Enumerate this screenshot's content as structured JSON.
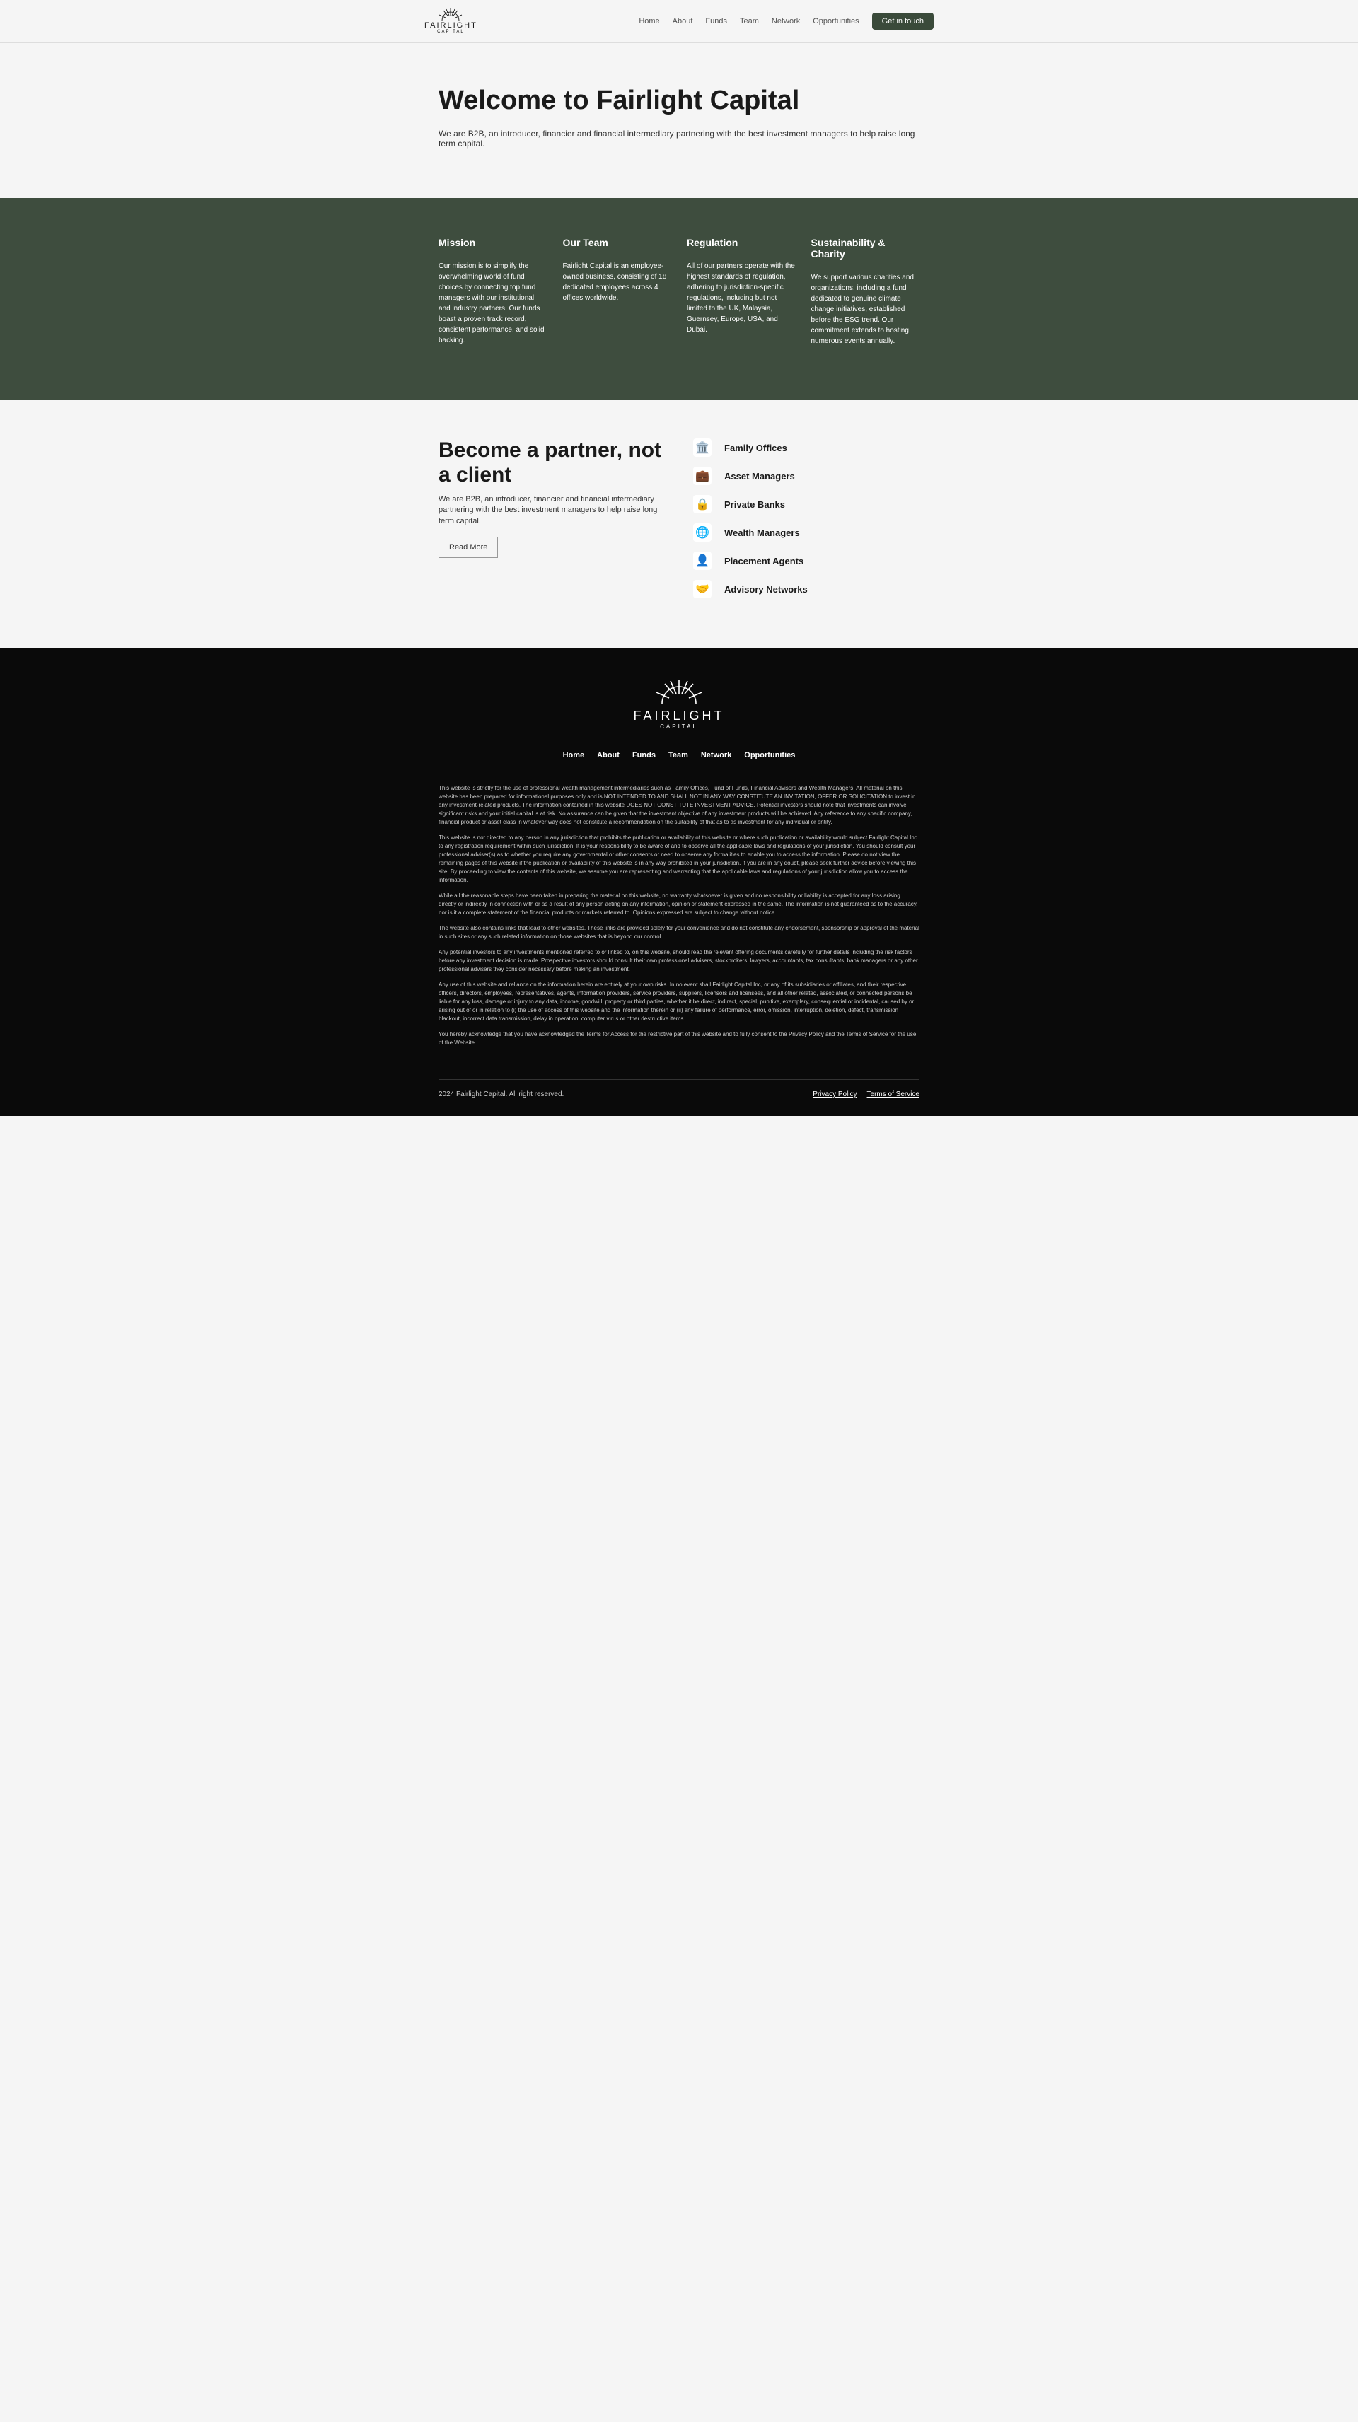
{
  "brand": {
    "name": "FAIRLIGHT",
    "sub": "CAPITAL"
  },
  "nav": {
    "home": "Home",
    "about": "About",
    "funds": "Funds",
    "team": "Team",
    "network": "Network",
    "opportunities": "Opportunities",
    "cta": "Get in touch"
  },
  "hero": {
    "title": "Welcome to Fairlight Capital",
    "sub": "We are B2B, an introducer, financier and financial intermediary partnering with the best investment managers to help raise long term capital."
  },
  "band": {
    "c1": {
      "h": "Mission",
      "p": "Our mission is to simplify the overwhelming world of fund choices by connecting top fund managers with our institutional and industry partners. Our funds boast a proven track record, consistent performance, and solid backing."
    },
    "c2": {
      "h": "Our Team",
      "p": "Fairlight Capital is an employee-owned business, consisting of 18 dedicated employees across 4 offices worldwide."
    },
    "c3": {
      "h": "Regulation",
      "p": "All of our partners operate with the highest standards of regulation, adhering to jurisdiction-specific regulations, including but not limited to the UK, Malaysia, Guernsey, Europe, USA, and Dubai."
    },
    "c4": {
      "h": "Sustainability & Charity",
      "p": "We support various charities and organizations, including a fund dedicated to genuine climate change initiatives, established before the ESG trend. Our commitment extends to hosting numerous events annually."
    }
  },
  "partner": {
    "title": "Become a partner, not a client",
    "sub": "We are B2B, an introducer, financier and financial intermediary partnering with the best investment managers to help raise long term capital.",
    "btn": "Read More",
    "items": {
      "i1": "Family Offices",
      "i2": "Asset Managers",
      "i3": "Private Banks",
      "i4": "Wealth Managers",
      "i5": "Placement Agents",
      "i6": "Advisory Networks"
    }
  },
  "disclaimer": {
    "p1": "This website is strictly for the use of professional wealth management intermediaries such as Family Offices, Fund of Funds, Financial Advisors and Wealth Managers. All material on this website has been prepared for informational purposes only and is NOT INTENDED TO AND SHALL NOT IN ANY WAY CONSTITUTE AN INVITATION, OFFER OR SOLICITATION to invest in any investment-related products. The information contained in this website DOES NOT CONSTITUTE INVESTMENT ADVICE. Potential investors should note that investments can involve significant risks and your initial capital is at risk. No assurance can be given that the investment objective of any investment products will be achieved. Any reference to any specific company, financial product or asset class in whatever way does not constitute a recommendation on the suitability of that as to as investment for any individual or entity.",
    "p2": "This website is not directed to any person in any jurisdiction that prohibits the publication or availability of this website or where such publication or availability would subject Fairlight Capital Inc to any registration requirement within such jurisdiction. It is your responsibility to be aware of and to observe all the applicable laws and regulations of your jurisdiction. You should consult your professional adviser(s) as to whether you require any governmental or other consents or need to observe any formalities to enable you to access the information. Please do not view the remaining pages of this website if the publication or availability of this website is in any way prohibited in your jurisdiction. If you are in any doubt, please seek further advice before viewing this site. By proceeding to view the contents of this website, we assume you are representing and warranting that the applicable laws and regulations of your jurisdiction allow you to access the information.",
    "p3": "While all the reasonable steps have been taken in preparing the material on this website, no warranty whatsoever is given and no responsibility or liability is accepted for any loss arising directly or indirectly in connection with or as a result of any person acting on any information, opinion or statement expressed in the same. The information is not guaranteed as to the accuracy, nor is it a complete statement of the financial products or markets referred to. Opinions expressed are subject to change without notice.",
    "p4": "The website also contains links that lead to other websites. These links are provided solely for your convenience and do not constitute any endorsement, sponsorship or approval of the material in such sites or any such related information on those websites that is beyond our control.",
    "p5": "Any potential investors to any investments mentioned referred to or linked to, on this website, should read the relevant offering documents carefully for further details including the risk factors before any investment decision is made. Prospective investors should consult their own professional advisers, stockbrokers, lawyers, accountants, tax consultants, bank managers or any other professional advisers they consider necessary before making an investment.",
    "p6": "Any use of this website and reliance on the information herein are entirely at your own risks. In no event shall Fairlight Capital Inc, or any of its subsidiaries or affiliates, and their respective officers, directors, employees, representatives, agents, information providers, service providers, suppliers, licensors and licensees, and all other related, associated, or connected persons be liable for any loss, damage or injury to any data, income, goodwill, property or third parties, whether it be direct, indirect, special, punitive, exemplary, consequential or incidental, caused by or arising out of or in relation to (i) the use of access of this website and the information therein or (ii) any failure of performance, error, omission, interruption, deletion, defect, transmission blackout, incorrect data transmission, delay in operation, computer virus or other destructive items.",
    "p7": "You hereby acknowledge that you have acknowledged the Terms for Access for the restrictive part of this website and to fully consent to the Privacy Policy and the Terms of Service for the use of the Website."
  },
  "footer": {
    "copyright": "2024 Fairlight Capital. All right reserved.",
    "privacy": "Privacy Policy",
    "terms": "Terms of Service"
  }
}
